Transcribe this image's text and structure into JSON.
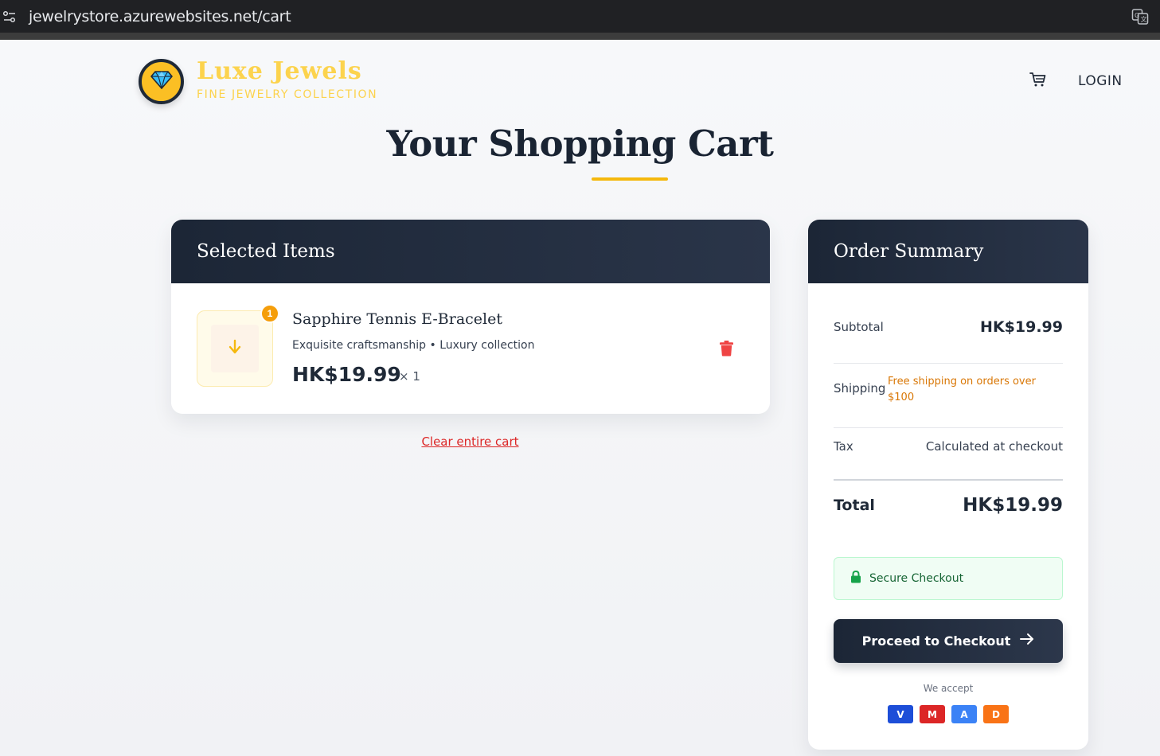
{
  "browser": {
    "url": "jewelrystore.azurewebsites.net/cart"
  },
  "header": {
    "brand_name": "Luxe Jewels",
    "brand_tagline": "FINE JEWELRY COLLECTION",
    "login_label": "LOGIN",
    "icons": [
      "diamond-icon",
      "cart-icon"
    ]
  },
  "page_title": "Your Shopping Cart",
  "items_section": {
    "title": "Selected Items",
    "items": [
      {
        "name": "Sapphire Tennis E-Bracelet",
        "description": "Exquisite craftsmanship • Luxury collection",
        "price": "HK$19.99",
        "quantity": "× 1",
        "badge": "1"
      }
    ],
    "clear_label": "Clear entire cart"
  },
  "summary": {
    "title": "Order Summary",
    "subtotal_label": "Subtotal",
    "subtotal_value": "HK$19.99",
    "shipping_label": "Shipping",
    "shipping_note": "Free shipping on orders over $100",
    "tax_label": "Tax",
    "tax_value": "Calculated at checkout",
    "total_label": "Total",
    "total_value": "HK$19.99",
    "secure_label": "Secure Checkout",
    "checkout_label": "Proceed to Checkout",
    "we_accept_label": "We accept",
    "payment_cards": [
      {
        "letter": "V",
        "color": "#1d4ed8"
      },
      {
        "letter": "M",
        "color": "#dc2626"
      },
      {
        "letter": "A",
        "color": "#3b82f6"
      },
      {
        "letter": "D",
        "color": "#f97316"
      }
    ]
  },
  "colors": {
    "accent": "#f5b80d",
    "dark": "#1c2636",
    "danger": "#dc2626",
    "shipping_note": "#d97706"
  }
}
